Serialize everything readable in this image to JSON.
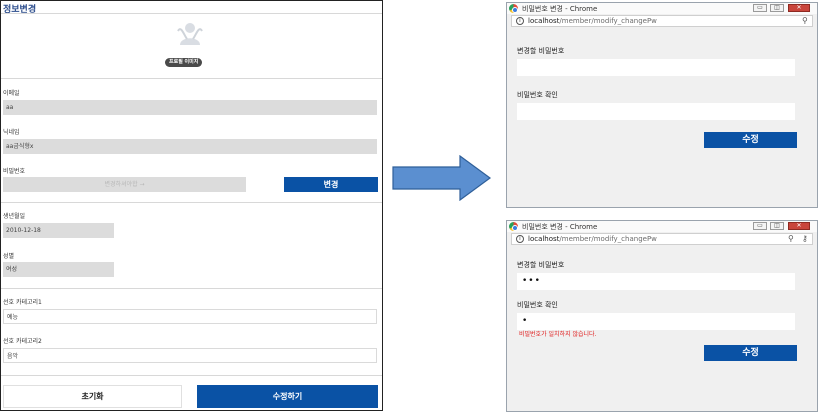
{
  "profile": {
    "title": "정보변경",
    "badge": "프로필 이미지",
    "email_label": "이메일",
    "email_value": "aa",
    "nickname_label": "닉네임",
    "nickname_value": "aa금식형x",
    "password_label": "비밀번호",
    "password_placeholder": "변경하셔야합 →",
    "change_button": "변경",
    "birth_label": "생년월일",
    "birth_value": "2010-12-18",
    "gender_label": "성별",
    "gender_value": "여성",
    "category1_label": "선호 카테고리1",
    "category1_value": "예능",
    "category2_label": "선호 카테고리2",
    "category2_value": "음악",
    "reset_button": "초기화",
    "submit_button": "수정하기"
  },
  "popup_top": {
    "window_title": "비밀번호 변경 - Chrome",
    "url_host": "localhost",
    "url_path": "/member/modify_changePw",
    "new_pw_label": "변경할 비밀번호",
    "new_pw_value": "",
    "confirm_label": "비밀번호 확인",
    "confirm_value": "",
    "submit_button": "수정"
  },
  "popup_bottom": {
    "window_title": "비밀번호 변경 - Chrome",
    "url_host": "localhost",
    "url_path": "/member/modify_changePw",
    "new_pw_label": "변경할 비밀번호",
    "new_pw_value": "•••",
    "confirm_label": "비밀번호 확인",
    "confirm_value": "•",
    "error_message": "비밀번호가 일치하지 않습니다.",
    "submit_button": "수정"
  },
  "window_controls": {
    "minimize": "▭",
    "restore": "◫",
    "close": "✕"
  },
  "icons": {
    "avatar": "avatar-icon",
    "arrow": "right-arrow",
    "search": "search-icon",
    "key": "key-icon",
    "info": "info-icon"
  },
  "colors": {
    "accent": "#0a52a5",
    "arrow": "#5b8fd0",
    "error": "#e02020",
    "title": "#2b4c8c"
  }
}
